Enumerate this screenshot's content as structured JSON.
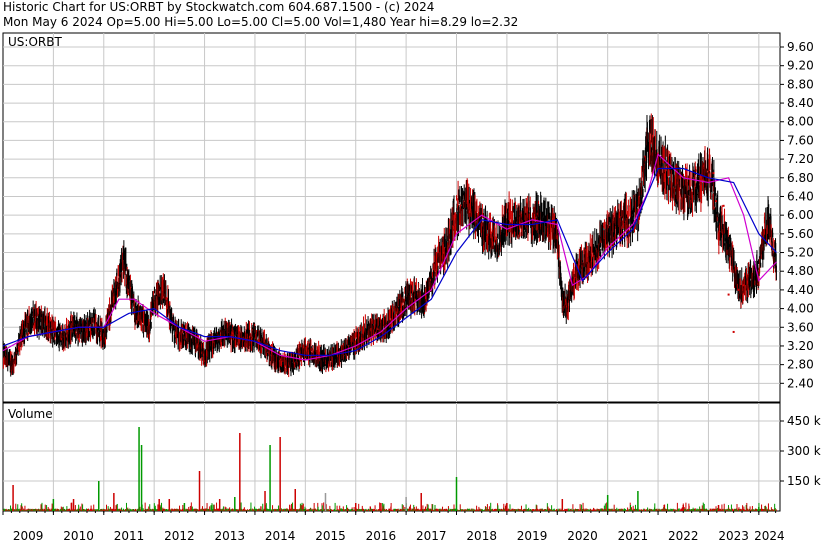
{
  "header": {
    "line1": "Historic Chart for US:ORBT by Stockwatch.com 604.687.1500 - (c) 2024",
    "line2": "Mon May  6 2024  Op=5.00  Hi=5.00  Lo=5.00  Cl=5.00  Vol=1,480  Year hi=8.29  lo=2.32"
  },
  "chart_data": [
    {
      "type": "line",
      "title": "US:ORBT",
      "ylim": [
        2.0,
        9.9
      ],
      "yticks": [
        "9.60",
        "9.20",
        "8.80",
        "8.40",
        "8.00",
        "7.60",
        "7.20",
        "6.80",
        "6.40",
        "6.00",
        "5.60",
        "5.20",
        "4.80",
        "4.40",
        "4.00",
        "3.60",
        "3.20",
        "2.80",
        "2.40"
      ],
      "xticks": [
        "2009",
        "2010",
        "2011",
        "2012",
        "2013",
        "2014",
        "2015",
        "2016",
        "2017",
        "2018",
        "2019",
        "2020",
        "2021",
        "2022",
        "2023",
        "2024"
      ],
      "xlim": [
        2009.0,
        2024.42
      ],
      "grid": true,
      "colors": {
        "price": "#000000",
        "down": "#cc0000",
        "ma_short": "#d000d0",
        "ma_long": "#0000cc"
      },
      "series": [
        {
          "name": "",
          "x": [
            2009.0,
            2009.2,
            2009.4,
            2009.6,
            2009.8,
            2010.0,
            2010.2,
            2010.4,
            2010.6,
            2010.8,
            2011.0,
            2011.1,
            2011.2,
            2011.4,
            2011.6,
            2011.8,
            2011.9,
            2012.0,
            2012.2,
            2012.4,
            2012.6,
            2012.8,
            2013.0,
            2013.2,
            2013.4,
            2013.6,
            2013.8,
            2014.0,
            2014.2,
            2014.4,
            2014.6,
            2014.8,
            2015.0,
            2015.2,
            2015.4,
            2015.6,
            2015.8,
            2016.0,
            2016.2,
            2016.4,
            2016.6,
            2016.8,
            2017.0,
            2017.2,
            2017.4,
            2017.6,
            2017.8,
            2018.0,
            2018.2,
            2018.4,
            2018.6,
            2018.8,
            2019.0,
            2019.2,
            2019.4,
            2019.6,
            2019.8,
            2020.0,
            2020.1,
            2020.2,
            2020.3,
            2020.4,
            2020.6,
            2020.8,
            2021.0,
            2021.2,
            2021.4,
            2021.6,
            2021.7,
            2021.8,
            2022.0,
            2022.2,
            2022.4,
            2022.6,
            2022.8,
            2023.0,
            2023.1,
            2023.2,
            2023.4,
            2023.6,
            2023.8,
            2024.0,
            2024.1,
            2024.2,
            2024.3,
            2024.35
          ],
          "values": [
            3.0,
            2.8,
            3.5,
            3.8,
            3.7,
            3.5,
            3.4,
            3.6,
            3.5,
            3.7,
            3.4,
            3.8,
            4.3,
            5.0,
            4.0,
            3.7,
            3.6,
            4.2,
            4.4,
            3.5,
            3.4,
            3.3,
            3.0,
            3.3,
            3.5,
            3.4,
            3.4,
            3.4,
            3.2,
            2.9,
            2.8,
            2.9,
            3.1,
            3.0,
            2.9,
            3.0,
            3.1,
            3.3,
            3.5,
            3.6,
            3.6,
            3.9,
            4.2,
            4.3,
            4.2,
            5.0,
            5.3,
            6.1,
            6.2,
            6.0,
            5.6,
            5.4,
            5.9,
            5.9,
            5.9,
            5.9,
            5.9,
            5.6,
            4.2,
            4.0,
            4.6,
            4.8,
            5.0,
            5.3,
            5.6,
            5.8,
            5.9,
            6.1,
            6.8,
            7.6,
            7.2,
            6.9,
            6.6,
            6.5,
            6.7,
            6.9,
            6.6,
            5.8,
            5.4,
            4.4,
            4.6,
            4.8,
            5.6,
            6.0,
            5.2,
            5.0
          ]
        },
        {
          "name": "",
          "x": [
            2009.0,
            2009.5,
            2010.0,
            2010.5,
            2011.0,
            2011.3,
            2011.6,
            2012.0,
            2012.5,
            2013.0,
            2013.5,
            2014.0,
            2014.5,
            2015.0,
            2015.5,
            2016.0,
            2016.5,
            2017.0,
            2017.5,
            2018.0,
            2018.5,
            2019.0,
            2019.5,
            2020.0,
            2020.3,
            2020.6,
            2021.0,
            2021.5,
            2021.8,
            2022.0,
            2022.5,
            2023.0,
            2023.4,
            2023.7,
            2024.0,
            2024.35
          ],
          "values": [
            3.1,
            3.4,
            3.5,
            3.6,
            3.6,
            4.2,
            4.2,
            3.9,
            3.6,
            3.3,
            3.4,
            3.3,
            3.0,
            2.9,
            3.0,
            3.2,
            3.5,
            4.0,
            4.4,
            5.6,
            6.0,
            5.7,
            5.9,
            5.8,
            4.5,
            4.7,
            5.3,
            5.8,
            6.5,
            7.3,
            6.8,
            6.7,
            6.8,
            6.0,
            4.6,
            5.0
          ]
        },
        {
          "name": "",
          "x": [
            2009.0,
            2009.5,
            2010.0,
            2010.5,
            2011.0,
            2011.5,
            2012.0,
            2012.5,
            2013.0,
            2013.5,
            2014.0,
            2014.5,
            2015.0,
            2015.5,
            2016.0,
            2016.5,
            2017.0,
            2017.5,
            2018.0,
            2018.5,
            2019.0,
            2019.5,
            2020.0,
            2020.5,
            2021.0,
            2021.5,
            2022.0,
            2022.5,
            2023.0,
            2023.5,
            2024.0,
            2024.35
          ],
          "values": [
            3.2,
            3.4,
            3.5,
            3.6,
            3.6,
            3.9,
            4.0,
            3.6,
            3.4,
            3.4,
            3.3,
            3.1,
            3.0,
            3.0,
            3.1,
            3.4,
            3.8,
            4.2,
            5.2,
            5.9,
            5.8,
            5.8,
            5.9,
            4.6,
            5.2,
            5.7,
            7.0,
            7.0,
            6.8,
            6.7,
            5.6,
            5.2
          ]
        }
      ],
      "down_points": {
        "x": [
          2023.1,
          2023.15,
          2023.3,
          2023.4,
          2023.5,
          2023.6,
          2023.7
        ],
        "values": [
          6.9,
          6.3,
          6.2,
          4.3,
          3.5,
          4.4,
          4.5
        ]
      }
    },
    {
      "type": "bar",
      "title": "Volume",
      "ylim": [
        0,
        540
      ],
      "yticks": [
        "450 k",
        "300 k",
        "150 k"
      ],
      "xticks": [
        "2009",
        "2010",
        "2011",
        "2012",
        "2013",
        "2014",
        "2015",
        "2016",
        "2017",
        "2018",
        "2019",
        "2020",
        "2021",
        "2022",
        "2023",
        "2024"
      ],
      "colors": {
        "up": "#009900",
        "down": "#cc0000",
        "flat": "#999999"
      },
      "spikes": {
        "x": [
          2009.2,
          2010.0,
          2010.4,
          2010.9,
          2011.2,
          2011.7,
          2011.75,
          2012.1,
          2012.3,
          2012.6,
          2012.9,
          2013.3,
          2013.6,
          2013.7,
          2014.2,
          2014.3,
          2014.5,
          2014.8,
          2015.4,
          2016.0,
          2016.5,
          2017.0,
          2017.3,
          2018.0,
          2019.0,
          2020.1,
          2021.0,
          2021.6,
          2022.5,
          2023.2,
          2024.0
        ],
        "values": [
          130,
          60,
          60,
          150,
          90,
          420,
          330,
          60,
          60,
          40,
          200,
          60,
          70,
          390,
          100,
          330,
          370,
          110,
          90,
          40,
          40,
          70,
          90,
          170,
          40,
          60,
          80,
          100,
          30,
          30,
          20
        ],
        "kinds": [
          "down",
          "up",
          "down",
          "up",
          "down",
          "up",
          "up",
          "down",
          "down",
          "up",
          "down",
          "down",
          "up",
          "down",
          "down",
          "up",
          "down",
          "down",
          "flat",
          "down",
          "down",
          "flat",
          "down",
          "up",
          "down",
          "down",
          "up",
          "up",
          "down",
          "down",
          "up"
        ]
      }
    }
  ]
}
